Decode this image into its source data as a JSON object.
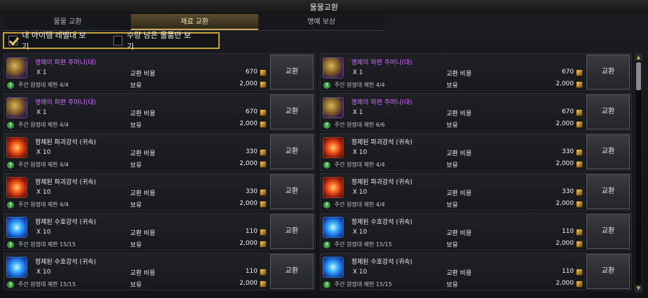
{
  "window": {
    "title": "물물교환"
  },
  "tabs": [
    {
      "label": "물물 교환",
      "active": false
    },
    {
      "label": "재료 교환",
      "active": true
    },
    {
      "label": "명예 보상",
      "active": false
    }
  ],
  "filters": [
    {
      "label": "내 아이템 레벨대 보기",
      "checked": true
    },
    {
      "label": "수량 남은 물품만 보기",
      "checked": false
    }
  ],
  "common": {
    "cost_label": "교환 비용",
    "own_label": "보유",
    "button_label": "교환"
  },
  "items": [
    {
      "name": "명예의 파편 주머니(대)",
      "qty": "X 1",
      "limit": "주간 원정대 제한 4/4",
      "cost": "670",
      "own": "2,000",
      "icon": "honor-shard-pouch-icon",
      "rarity": "epic"
    },
    {
      "name": "명예의 파편 주머니(대)",
      "qty": "X 1",
      "limit": "주간 원정대 제한 4/4",
      "cost": "670",
      "own": "2,000",
      "icon": "honor-shard-pouch-icon",
      "rarity": "epic"
    },
    {
      "name": "명예의 파편 주머니(대)",
      "qty": "X 1",
      "limit": "주간 원정대 제한 4/4",
      "cost": "670",
      "own": "2,000",
      "icon": "honor-shard-pouch-icon",
      "rarity": "epic"
    },
    {
      "name": "명예의 파편 주머니(대)",
      "qty": "X 1",
      "limit": "주간 원정대 제한 6/6",
      "cost": "670",
      "own": "2,000",
      "icon": "honor-shard-pouch-icon",
      "rarity": "epic"
    },
    {
      "name": "정제된 파괴강석 (귀속)",
      "qty": "X 10",
      "limit": "주간 원정대 제한 4/4",
      "cost": "330",
      "own": "2,000",
      "icon": "destruction-stone-icon",
      "rarity": "normal"
    },
    {
      "name": "정제된 파괴강석 (귀속)",
      "qty": "X 10",
      "limit": "주간 원정대 제한 4/4",
      "cost": "330",
      "own": "2,000",
      "icon": "destruction-stone-icon",
      "rarity": "normal"
    },
    {
      "name": "정제된 파괴강석 (귀속)",
      "qty": "X 10",
      "limit": "주간 원정대 제한 4/4",
      "cost": "330",
      "own": "2,000",
      "icon": "destruction-stone-icon",
      "rarity": "normal"
    },
    {
      "name": "정제된 파괴강석 (귀속)",
      "qty": "X 10",
      "limit": "주간 원정대 제한 4/4",
      "cost": "330",
      "own": "2,000",
      "icon": "destruction-stone-icon",
      "rarity": "normal"
    },
    {
      "name": "정제된 수호강석 (귀속)",
      "qty": "X 10",
      "limit": "주간 원정대 제한 15/15",
      "cost": "110",
      "own": "2,000",
      "icon": "guardian-stone-icon",
      "rarity": "normal"
    },
    {
      "name": "정제된 수호강석 (귀속)",
      "qty": "X 10",
      "limit": "주간 원정대 제한 15/15",
      "cost": "110",
      "own": "2,000",
      "icon": "guardian-stone-icon",
      "rarity": "normal"
    },
    {
      "name": "정제된 수호강석 (귀속)",
      "qty": "X 10",
      "limit": "주간 원정대 제한 15/15",
      "cost": "110",
      "own": "2,000",
      "icon": "guardian-stone-icon",
      "rarity": "normal"
    },
    {
      "name": "정제된 수호강석 (귀속)",
      "qty": "X 10",
      "limit": "주간 원정대 제한 15/15",
      "cost": "110",
      "own": "2,000",
      "icon": "guardian-stone-icon",
      "rarity": "normal"
    }
  ],
  "colors": {
    "epic_name": "#d46cff",
    "accent_gold": "#c9a33d",
    "limit_icon": "#3a9b3d"
  },
  "scrollbar": {
    "up_icon": "▲",
    "down_icon": "▼"
  }
}
